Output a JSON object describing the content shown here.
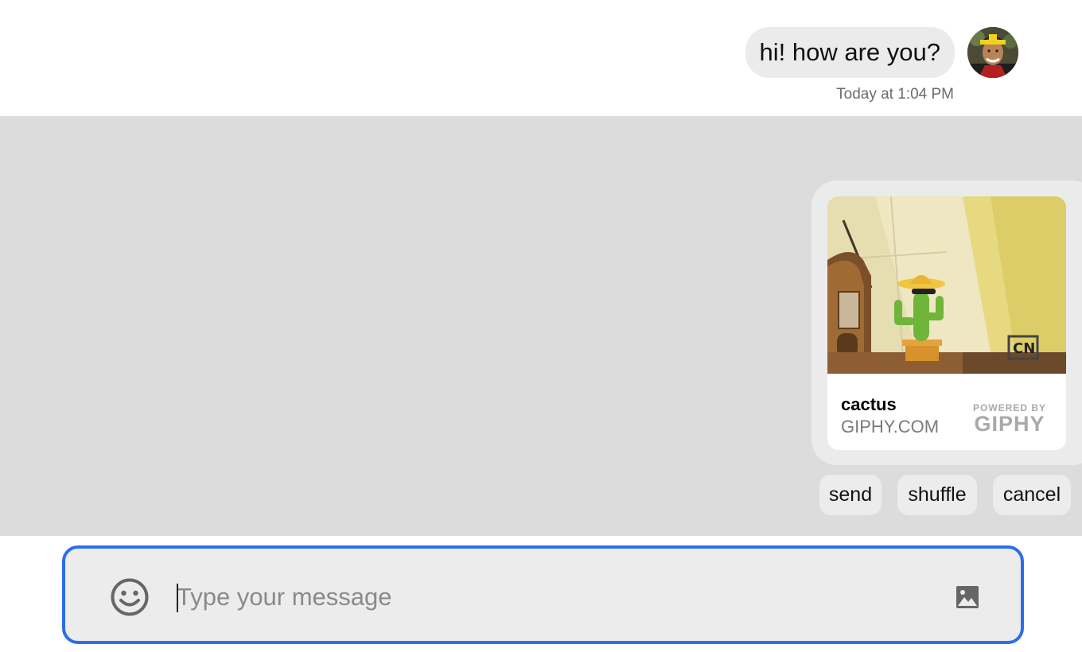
{
  "conversation": {
    "messages": [
      {
        "text": "hi! how are you?",
        "timestamp": "Today at 1:04 PM",
        "avatar": "user-avatar"
      }
    ]
  },
  "giphy_preview": {
    "title": "cactus",
    "source": "GIPHY.COM",
    "powered_by_line1": "POWERED BY",
    "powered_by_line2": "GIPHY",
    "watermark": "CN",
    "actions": {
      "send": "send",
      "shuffle": "shuffle",
      "cancel": "cancel"
    }
  },
  "composer": {
    "placeholder": "Type your message",
    "value": "",
    "emoji_icon": "smiley-icon",
    "image_icon": "image-icon"
  },
  "colors": {
    "accent": "#2b6fe8",
    "panel_bg": "#dcdcdc",
    "bubble_bg": "#ebebeb"
  }
}
